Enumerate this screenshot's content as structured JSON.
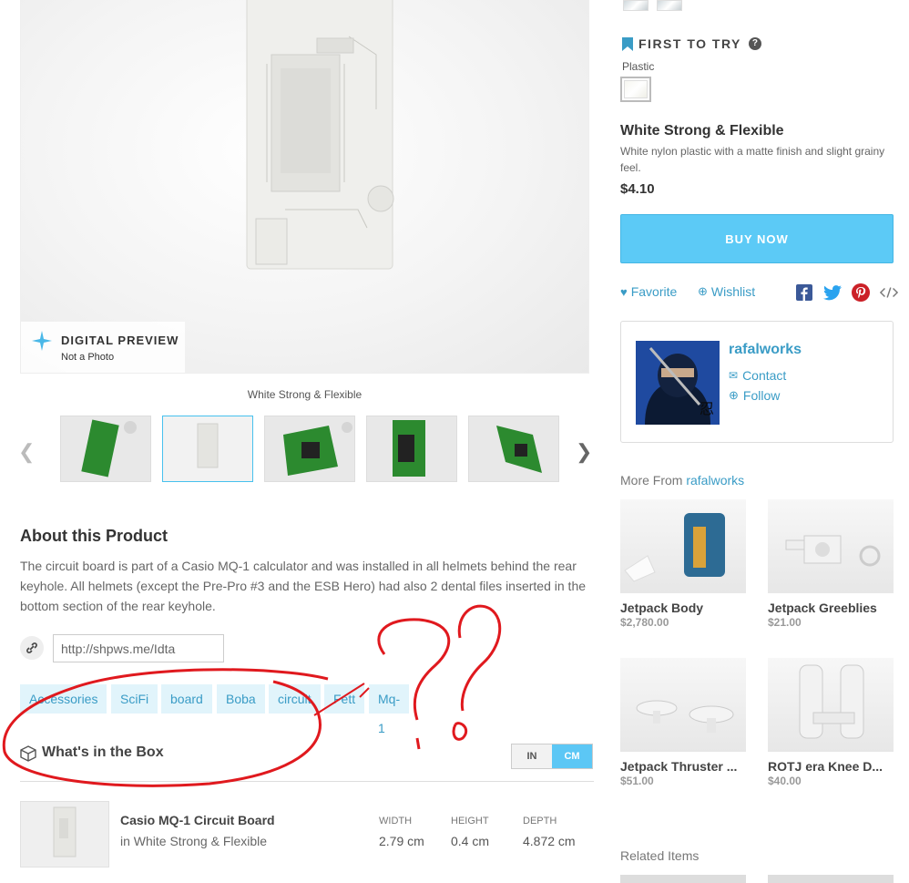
{
  "preview": {
    "badge_title": "DIGITAL PREVIEW",
    "badge_subtitle": "Not a Photo",
    "caption": "White Strong & Flexible"
  },
  "thumbnails": [
    {
      "label": "green-board-angle"
    },
    {
      "label": "white-board",
      "active": true
    },
    {
      "label": "green-board-flat"
    },
    {
      "label": "green-board-front"
    },
    {
      "label": "green-board-tilt"
    }
  ],
  "about": {
    "title": "About this Product",
    "text": "The circuit board is part of a Casio MQ-1 calculator and was installed in all helmets behind the rear keyhole. All helmets (except the Pre-Pro #3 and the ESB Hero) had also 2 dental files inserted in the bottom section of the rear keyhole."
  },
  "share_link": {
    "value": "http://shpws.me/Idta"
  },
  "tags": [
    "Accessories",
    "SciFi",
    "board",
    "Boba",
    "circuit",
    "Fett",
    "Mq-1"
  ],
  "box": {
    "title": "What's in the Box",
    "unit_in": "IN",
    "unit_cm": "CM",
    "selected_unit": "CM",
    "item": {
      "name": "Casio MQ-1 Circuit Board",
      "material": "in White Strong & Flexible",
      "width_label": "WIDTH",
      "height_label": "HEIGHT",
      "depth_label": "DEPTH",
      "width": "2.79 cm",
      "height": "0.4 cm",
      "depth": "4.872 cm"
    }
  },
  "material": {
    "section": "FIRST TO TRY",
    "category": "Plastic",
    "name": "White Strong & Flexible",
    "description": "White nylon plastic with a matte finish and slight grainy feel.",
    "price": "$4.10"
  },
  "actions": {
    "buy_now": "BUY NOW",
    "favorite": "Favorite",
    "wishlist": "Wishlist",
    "share_icons": [
      "facebook-icon",
      "twitter-icon",
      "pinterest-icon",
      "embed-icon"
    ]
  },
  "seller": {
    "name": "rafalworks",
    "contact": "Contact",
    "follow": "Follow"
  },
  "more_from": {
    "prefix": "More From",
    "shop": "rafalworks",
    "products": [
      {
        "name": "Jetpack Body",
        "price": "$2,780.00"
      },
      {
        "name": "Jetpack Greeblies",
        "price": "$21.00"
      },
      {
        "name": "Jetpack Thruster ...",
        "price": "$51.00"
      },
      {
        "name": "ROTJ era Knee D...",
        "price": "$40.00"
      }
    ]
  },
  "related": {
    "title": "Related Items"
  },
  "colors": {
    "accent": "#3a9cc6",
    "buy_button": "#5ccaf6",
    "tag_bg": "#e1f4fb",
    "annotation": "#e0191e"
  }
}
